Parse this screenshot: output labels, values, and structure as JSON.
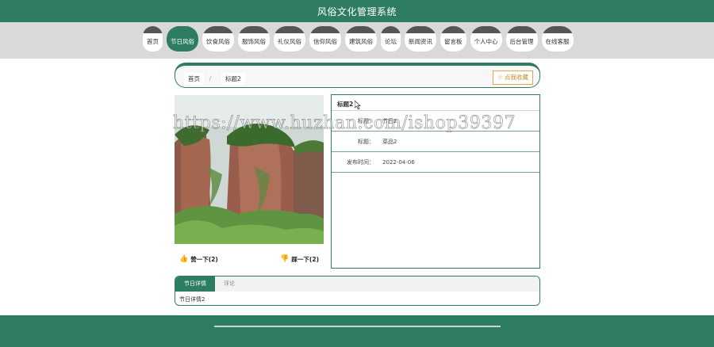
{
  "app": {
    "title": "风俗文化管理系统"
  },
  "nav": [
    {
      "label": "首页",
      "active": false
    },
    {
      "label": "节日风俗",
      "active": true
    },
    {
      "label": "饮食风俗",
      "active": false
    },
    {
      "label": "服饰风俗",
      "active": false
    },
    {
      "label": "礼仪风俗",
      "active": false
    },
    {
      "label": "信仰风俗",
      "active": false
    },
    {
      "label": "建筑风俗",
      "active": false
    },
    {
      "label": "论坛",
      "active": false
    },
    {
      "label": "新闻资讯",
      "active": false
    },
    {
      "label": "留言板",
      "active": false
    },
    {
      "label": "个人中心",
      "active": false
    },
    {
      "label": "后台管理",
      "active": false
    },
    {
      "label": "在线客服",
      "active": false
    }
  ],
  "breadcrumb": {
    "home": "首页",
    "sep": "/",
    "current": "标题2"
  },
  "favorite": {
    "label": "点我收藏",
    "icon": "star-outline-icon"
  },
  "vote": {
    "up_label": "赞一下(2)",
    "down_label": "踩一下(2)",
    "up_icon": "thumbs-up-icon",
    "down_icon": "thumbs-down-icon"
  },
  "info": {
    "title": "标题2",
    "rows": [
      {
        "key": "标题：",
        "value": "节日2"
      },
      {
        "key": "标题：",
        "value": "菜品2"
      },
      {
        "key": "发布时间：",
        "value": "2022-04-06"
      }
    ]
  },
  "detail": {
    "tabs": [
      {
        "label": "节日详情",
        "active": true
      },
      {
        "label": "评论",
        "active": false
      }
    ],
    "content": "节日详情2"
  },
  "watermark": "https://www.huzhan.com/ishop39397",
  "colors": {
    "primary": "#2e7d62",
    "nav_band": "#d9d9d9",
    "favorite": "#e3a84a",
    "thumb": "#dd3333"
  }
}
